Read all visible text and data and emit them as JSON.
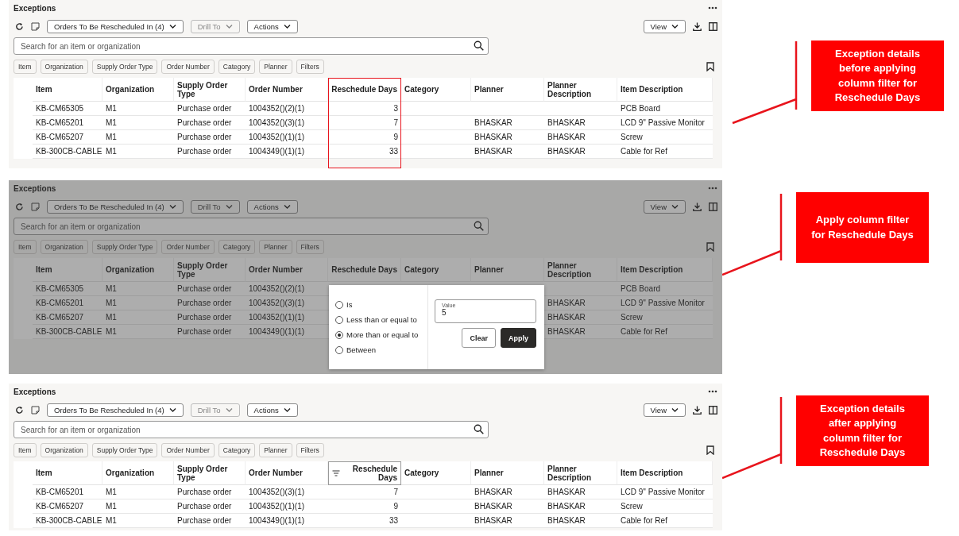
{
  "panels": [
    {
      "title": "Exceptions",
      "dimmed": false,
      "toolbar": {
        "saved_search": "Orders To Be Rescheduled In (4)",
        "drill_to": {
          "label": "Drill To",
          "disabled": true
        },
        "actions": "Actions",
        "view": "View"
      },
      "search": {
        "placeholder": "Search for an item or organization"
      },
      "filter_chips": [
        "Item",
        "Organization",
        "Supply Order Type",
        "Order Number",
        "Category",
        "Planner",
        "Filters"
      ],
      "table": {
        "columns": [
          {
            "label": "Item",
            "kind": "text",
            "highlighted": false,
            "filtered": false
          },
          {
            "label": "Organization",
            "kind": "text",
            "highlighted": false,
            "filtered": false
          },
          {
            "label": "Supply Order Type",
            "kind": "text",
            "highlighted": false,
            "filtered": false
          },
          {
            "label": "Order Number",
            "kind": "text",
            "highlighted": false,
            "filtered": false
          },
          {
            "label": "Reschedule Days",
            "kind": "number",
            "highlighted": true,
            "filtered": false
          },
          {
            "label": "Category",
            "kind": "text",
            "highlighted": false,
            "filtered": false
          },
          {
            "label": "Planner",
            "kind": "text",
            "highlighted": false,
            "filtered": false
          },
          {
            "label": "Planner Description",
            "kind": "text",
            "highlighted": false,
            "filtered": false
          },
          {
            "label": "Item Description",
            "kind": "text",
            "highlighted": false,
            "filtered": false
          }
        ],
        "rows": [
          [
            "KB-CM65305",
            "M1",
            "Purchase order",
            "1004352()(2)(1)",
            "3",
            "",
            "",
            "",
            "PCB Board"
          ],
          [
            "KB-CM65201",
            "M1",
            "Purchase order",
            "1004352()(3)(1)",
            "7",
            "",
            "BHASKAR",
            "BHASKAR",
            "LCD 9\" Passive Monitor"
          ],
          [
            "KB-CM65207",
            "M1",
            "Purchase order",
            "1004352()(1)(1)",
            "9",
            "",
            "BHASKAR",
            "BHASKAR",
            "Screw"
          ],
          [
            "KB-300CB-CABLE",
            "M1",
            "Purchase order",
            "1004349()(1)(1)",
            "33",
            "",
            "BHASKAR",
            "BHASKAR",
            "Cable for Ref"
          ]
        ]
      }
    },
    {
      "title": "Exceptions",
      "dimmed": true,
      "toolbar": {
        "saved_search": "Orders To Be Rescheduled In (4)",
        "drill_to": {
          "label": "Drill To",
          "disabled": true
        },
        "actions": "Actions",
        "view": "View"
      },
      "search": {
        "placeholder": "Search for an item or organization"
      },
      "filter_chips": [
        "Item",
        "Organization",
        "Supply Order Type",
        "Order Number",
        "Category",
        "Planner",
        "Filters"
      ],
      "table": {
        "columns": [
          {
            "label": "Item",
            "kind": "text",
            "highlighted": false,
            "filtered": false
          },
          {
            "label": "Organization",
            "kind": "text",
            "highlighted": false,
            "filtered": false
          },
          {
            "label": "Supply Order Type",
            "kind": "text",
            "highlighted": false,
            "filtered": false
          },
          {
            "label": "Order Number",
            "kind": "text",
            "highlighted": false,
            "filtered": false
          },
          {
            "label": "Reschedule Days",
            "kind": "number",
            "highlighted": false,
            "filtered": false
          },
          {
            "label": "Category",
            "kind": "text",
            "highlighted": false,
            "filtered": false
          },
          {
            "label": "Planner",
            "kind": "text",
            "highlighted": false,
            "filtered": false
          },
          {
            "label": "Planner Description",
            "kind": "text",
            "highlighted": false,
            "filtered": false
          },
          {
            "label": "Item Description",
            "kind": "text",
            "highlighted": false,
            "filtered": false
          }
        ],
        "rows": [
          [
            "KB-CM65305",
            "M1",
            "Purchase order",
            "1004352()(2)(1)",
            "",
            "",
            "",
            "",
            "PCB Board"
          ],
          [
            "KB-CM65201",
            "M1",
            "Purchase order",
            "1004352()(3)(1)",
            "",
            "",
            "",
            "BHASKAR",
            "LCD 9\" Passive Monitor"
          ],
          [
            "KB-CM65207",
            "M1",
            "Purchase order",
            "1004352()(1)(1)",
            "",
            "",
            "",
            "BHASKAR",
            "Screw"
          ],
          [
            "KB-300CB-CABLE",
            "M1",
            "Purchase order",
            "1004349()(1)(1)",
            "",
            "",
            "",
            "BHASKAR",
            "Cable for Ref"
          ]
        ]
      },
      "filter_popup": {
        "options": [
          {
            "label": "Is",
            "selected": false
          },
          {
            "label": "Less than or equal to",
            "selected": false
          },
          {
            "label": "More than or equal to",
            "selected": true
          },
          {
            "label": "Between",
            "selected": false
          }
        ],
        "value_field": {
          "label": "Value",
          "value": "5"
        },
        "buttons": [
          {
            "label": "Clear",
            "kind": "secondary"
          },
          {
            "label": "Apply",
            "kind": "primary"
          }
        ]
      }
    },
    {
      "title": "Exceptions",
      "dimmed": false,
      "toolbar": {
        "saved_search": "Orders To Be Rescheduled In (4)",
        "drill_to": {
          "label": "Drill To",
          "disabled": true
        },
        "actions": "Actions",
        "view": "View"
      },
      "search": {
        "placeholder": "Search for an item or organization"
      },
      "filter_chips": [
        "Item",
        "Organization",
        "Supply Order Type",
        "Order Number",
        "Category",
        "Planner",
        "Filters"
      ],
      "table": {
        "columns": [
          {
            "label": "Item",
            "kind": "text",
            "highlighted": false,
            "filtered": false
          },
          {
            "label": "Organization",
            "kind": "text",
            "highlighted": false,
            "filtered": false
          },
          {
            "label": "Supply Order Type",
            "kind": "text",
            "highlighted": false,
            "filtered": false
          },
          {
            "label": "Order Number",
            "kind": "text",
            "highlighted": false,
            "filtered": false
          },
          {
            "label": "Reschedule Days",
            "kind": "number",
            "highlighted": false,
            "filtered": true
          },
          {
            "label": "Category",
            "kind": "text",
            "highlighted": false,
            "filtered": false
          },
          {
            "label": "Planner",
            "kind": "text",
            "highlighted": false,
            "filtered": false
          },
          {
            "label": "Planner Description",
            "kind": "text",
            "highlighted": false,
            "filtered": false
          },
          {
            "label": "Item Description",
            "kind": "text",
            "highlighted": false,
            "filtered": false
          }
        ],
        "rows": [
          [
            "KB-CM65201",
            "M1",
            "Purchase order",
            "1004352()(3)(1)",
            "7",
            "",
            "BHASKAR",
            "BHASKAR",
            "LCD 9\" Passive Monitor"
          ],
          [
            "KB-CM65207",
            "M1",
            "Purchase order",
            "1004352()(1)(1)",
            "9",
            "",
            "BHASKAR",
            "BHASKAR",
            "Screw"
          ],
          [
            "KB-300CB-CABLE",
            "M1",
            "Purchase order",
            "1004349()(1)(1)",
            "33",
            "",
            "BHASKAR",
            "BHASKAR",
            "Cable for Ref"
          ]
        ]
      }
    }
  ],
  "callouts": [
    {
      "text": "Exception details before applying column filter for Reschedule Days"
    },
    {
      "text": "Apply column filter for Reschedule Days"
    },
    {
      "text": "Exception details after applying column filter for Reschedule Days"
    }
  ]
}
